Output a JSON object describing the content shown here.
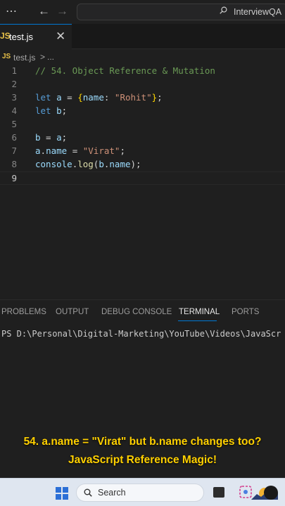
{
  "titlebar": {
    "menu_glyph": "⋯",
    "back_glyph": "←",
    "forward_glyph": "→",
    "search_text": "InterviewQA"
  },
  "tab": {
    "lang_badge": "JS",
    "label": "test.js",
    "close_glyph": "✕"
  },
  "breadcrumb": {
    "lang_badge": "JS",
    "file": "test.js",
    "separator": ">",
    "more": "..."
  },
  "editor": {
    "active_line": 9,
    "lines": [
      {
        "num": "1",
        "tokens": [
          {
            "t": "// 54. Object Reference & Mutation",
            "c": "cm"
          }
        ]
      },
      {
        "num": "2",
        "tokens": []
      },
      {
        "num": "3",
        "tokens": [
          {
            "t": "let",
            "c": "kw"
          },
          {
            "t": " ",
            "c": "op"
          },
          {
            "t": "a",
            "c": "var"
          },
          {
            "t": " = ",
            "c": "op"
          },
          {
            "t": "{",
            "c": "brace"
          },
          {
            "t": "name",
            "c": "var"
          },
          {
            "t": ": ",
            "c": "op"
          },
          {
            "t": "\"Rohit\"",
            "c": "str"
          },
          {
            "t": "}",
            "c": "brace"
          },
          {
            "t": ";",
            "c": "op"
          }
        ]
      },
      {
        "num": "4",
        "tokens": [
          {
            "t": "let",
            "c": "kw"
          },
          {
            "t": " ",
            "c": "op"
          },
          {
            "t": "b",
            "c": "var"
          },
          {
            "t": ";",
            "c": "op"
          }
        ]
      },
      {
        "num": "5",
        "tokens": []
      },
      {
        "num": "6",
        "tokens": [
          {
            "t": "b",
            "c": "var"
          },
          {
            "t": " = ",
            "c": "op"
          },
          {
            "t": "a",
            "c": "var"
          },
          {
            "t": ";",
            "c": "op"
          }
        ]
      },
      {
        "num": "7",
        "tokens": [
          {
            "t": "a",
            "c": "var"
          },
          {
            "t": ".",
            "c": "op"
          },
          {
            "t": "name",
            "c": "var"
          },
          {
            "t": " = ",
            "c": "op"
          },
          {
            "t": "\"Virat\"",
            "c": "str"
          },
          {
            "t": ";",
            "c": "op"
          }
        ]
      },
      {
        "num": "8",
        "tokens": [
          {
            "t": "console",
            "c": "var"
          },
          {
            "t": ".",
            "c": "op"
          },
          {
            "t": "log",
            "c": "fn"
          },
          {
            "t": "(",
            "c": "op"
          },
          {
            "t": "b",
            "c": "var"
          },
          {
            "t": ".",
            "c": "op"
          },
          {
            "t": "name",
            "c": "var"
          },
          {
            "t": ");",
            "c": "op"
          }
        ]
      },
      {
        "num": "9",
        "tokens": []
      }
    ]
  },
  "panel": {
    "tabs": [
      "PROBLEMS",
      "OUTPUT",
      "DEBUG CONSOLE",
      "TERMINAL",
      "PORTS"
    ],
    "active_tab": "TERMINAL",
    "terminal_line": "PS D:\\Personal\\Digital-Marketing\\YouTube\\Videos\\JavaScr"
  },
  "caption": {
    "line1": "54. a.name = \"Virat\" but b.name changes too?",
    "line2": "JavaScript Reference Magic!"
  },
  "taskbar": {
    "search_label": "Search"
  },
  "colors": {
    "accent": "#0078d4",
    "caption": "#ffd000",
    "comment": "#6a9955",
    "keyword": "#569cd6",
    "string": "#ce9178"
  }
}
